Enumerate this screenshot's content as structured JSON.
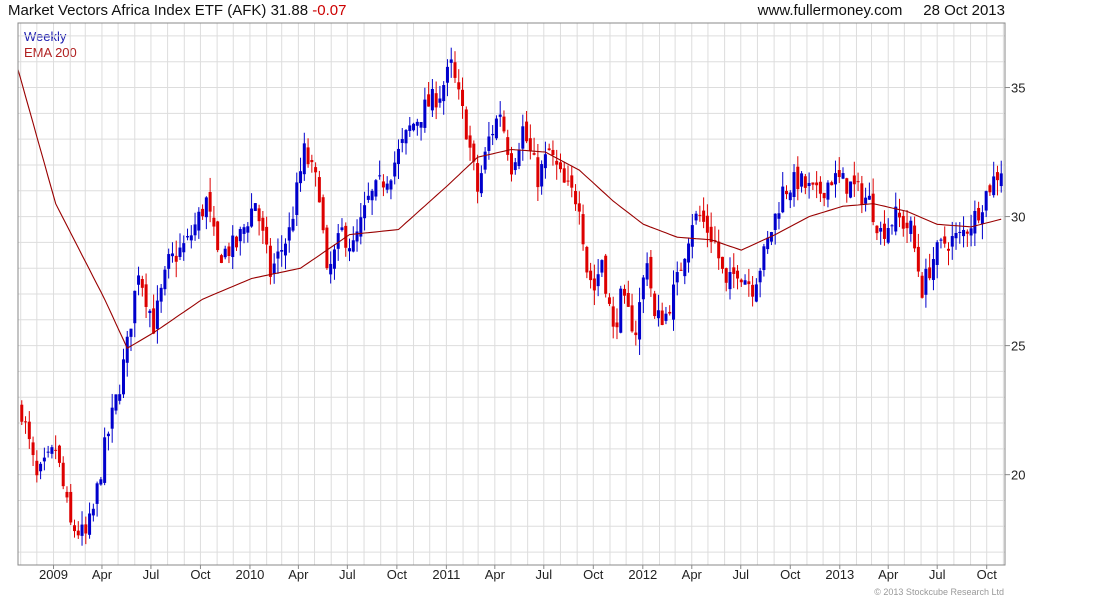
{
  "header": {
    "instrument": "Market Vectors Africa Index ETF (AFK)",
    "last": "31.88",
    "change": "-0.07",
    "source": "www.fullermoney.com",
    "date": "28 Oct 2013"
  },
  "legend": {
    "series1": "Weekly",
    "series2": "EMA 200"
  },
  "footer": {
    "copyright": "© 2013 Stockcube Research Ltd"
  },
  "colors": {
    "up": "#0000cc",
    "down": "#dd0000",
    "ema": "#990000",
    "grid": "#dddddd"
  },
  "chart_data": {
    "type": "bar",
    "subtype": "weekly candlestick with 200-period EMA",
    "x_range": [
      "2008-10-27",
      "2013-11-04"
    ],
    "y_range": [
      16.5,
      37.5
    ],
    "y_ticks": [
      20,
      25,
      30,
      35
    ],
    "x_ticks": [
      {
        "label": "2009",
        "date": "2009-01-01"
      },
      {
        "label": "Apr",
        "date": "2009-04-01"
      },
      {
        "label": "Jul",
        "date": "2009-07-01"
      },
      {
        "label": "Oct",
        "date": "2009-10-01"
      },
      {
        "label": "2010",
        "date": "2010-01-01"
      },
      {
        "label": "Apr",
        "date": "2010-04-01"
      },
      {
        "label": "Jul",
        "date": "2010-07-01"
      },
      {
        "label": "Oct",
        "date": "2010-10-01"
      },
      {
        "label": "2011",
        "date": "2011-01-01"
      },
      {
        "label": "Apr",
        "date": "2011-04-01"
      },
      {
        "label": "Jul",
        "date": "2011-07-01"
      },
      {
        "label": "Oct",
        "date": "2011-10-01"
      },
      {
        "label": "2012",
        "date": "2012-01-01"
      },
      {
        "label": "Apr",
        "date": "2012-04-01"
      },
      {
        "label": "Jul",
        "date": "2012-07-01"
      },
      {
        "label": "Oct",
        "date": "2012-10-01"
      },
      {
        "label": "2013",
        "date": "2013-01-01"
      },
      {
        "label": "Apr",
        "date": "2013-04-01"
      },
      {
        "label": "Jul",
        "date": "2013-07-01"
      },
      {
        "label": "Oct",
        "date": "2013-10-01"
      }
    ],
    "close_anchors": [
      [
        "2008-11-03",
        22.5
      ],
      [
        "2008-12-01",
        19.8
      ],
      [
        "2009-01-05",
        21.0
      ],
      [
        "2009-02-02",
        18.0
      ],
      [
        "2009-03-02",
        17.6
      ],
      [
        "2009-03-16",
        18.6
      ],
      [
        "2009-04-06",
        21.0
      ],
      [
        "2009-05-04",
        23.5
      ],
      [
        "2009-05-18",
        25.0
      ],
      [
        "2009-06-08",
        28.0
      ],
      [
        "2009-07-06",
        25.8
      ],
      [
        "2009-08-03",
        28.2
      ],
      [
        "2009-09-07",
        29.0
      ],
      [
        "2009-10-12",
        30.6
      ],
      [
        "2009-11-02",
        28.5
      ],
      [
        "2009-12-07",
        28.9
      ],
      [
        "2010-01-11",
        30.6
      ],
      [
        "2010-02-08",
        27.8
      ],
      [
        "2010-03-15",
        29.4
      ],
      [
        "2010-04-12",
        32.5
      ],
      [
        "2010-05-10",
        31.0
      ],
      [
        "2010-05-24",
        27.6
      ],
      [
        "2010-06-21",
        29.4
      ],
      [
        "2010-07-12",
        28.8
      ],
      [
        "2010-08-09",
        30.6
      ],
      [
        "2010-09-20",
        31.8
      ],
      [
        "2010-10-25",
        33.4
      ],
      [
        "2010-11-22",
        34.2
      ],
      [
        "2010-12-20",
        34.8
      ],
      [
        "2011-01-10",
        35.8
      ],
      [
        "2011-02-07",
        33.4
      ],
      [
        "2011-02-28",
        31.0
      ],
      [
        "2011-03-21",
        33.0
      ],
      [
        "2011-04-11",
        34.1
      ],
      [
        "2011-05-02",
        32.0
      ],
      [
        "2011-05-23",
        33.4
      ],
      [
        "2011-06-20",
        31.5
      ],
      [
        "2011-07-11",
        32.5
      ],
      [
        "2011-08-08",
        31.2
      ],
      [
        "2011-09-05",
        30.6
      ],
      [
        "2011-09-19",
        28.0
      ],
      [
        "2011-10-03",
        27.2
      ],
      [
        "2011-10-17",
        28.4
      ],
      [
        "2011-11-07",
        25.5
      ],
      [
        "2011-11-21",
        26.8
      ],
      [
        "2011-12-19",
        25.6
      ],
      [
        "2012-01-09",
        28.5
      ],
      [
        "2012-01-23",
        26.0
      ],
      [
        "2012-02-13",
        26.2
      ],
      [
        "2012-03-05",
        27.5
      ],
      [
        "2012-04-02",
        29.9
      ],
      [
        "2012-04-16",
        30.0
      ],
      [
        "2012-05-14",
        29.0
      ],
      [
        "2012-06-04",
        27.2
      ],
      [
        "2012-06-25",
        28.0
      ],
      [
        "2012-07-23",
        27.3
      ],
      [
        "2012-08-13",
        28.5
      ],
      [
        "2012-09-17",
        31.0
      ],
      [
        "2012-10-15",
        31.4
      ],
      [
        "2012-11-19",
        30.8
      ],
      [
        "2012-12-17",
        31.5
      ],
      [
        "2013-01-21",
        31.2
      ],
      [
        "2013-02-25",
        30.6
      ],
      [
        "2013-03-18",
        29.4
      ],
      [
        "2013-04-15",
        30.0
      ],
      [
        "2013-05-13",
        29.5
      ],
      [
        "2013-06-03",
        27.2
      ],
      [
        "2013-06-24",
        28.4
      ],
      [
        "2013-07-15",
        29.0
      ],
      [
        "2013-08-12",
        29.2
      ],
      [
        "2013-09-09",
        30.0
      ],
      [
        "2013-10-07",
        31.2
      ],
      [
        "2013-10-28",
        31.88
      ]
    ],
    "ema_anchors": [
      [
        "2008-10-27",
        35.7
      ],
      [
        "2009-01-05",
        30.5
      ],
      [
        "2009-04-06",
        26.8
      ],
      [
        "2009-05-18",
        24.9
      ],
      [
        "2009-07-06",
        25.5
      ],
      [
        "2009-10-05",
        26.8
      ],
      [
        "2010-01-04",
        27.6
      ],
      [
        "2010-04-05",
        28.0
      ],
      [
        "2010-07-05",
        29.3
      ],
      [
        "2010-10-04",
        29.5
      ],
      [
        "2011-01-03",
        31.2
      ],
      [
        "2011-02-28",
        32.3
      ],
      [
        "2011-05-02",
        32.6
      ],
      [
        "2011-07-04",
        32.5
      ],
      [
        "2011-09-05",
        31.8
      ],
      [
        "2011-11-07",
        30.6
      ],
      [
        "2012-01-02",
        29.7
      ],
      [
        "2012-03-05",
        29.2
      ],
      [
        "2012-05-07",
        29.1
      ],
      [
        "2012-07-02",
        28.7
      ],
      [
        "2012-09-03",
        29.3
      ],
      [
        "2012-11-05",
        30.0
      ],
      [
        "2013-01-07",
        30.4
      ],
      [
        "2013-03-04",
        30.5
      ],
      [
        "2013-05-06",
        30.2
      ],
      [
        "2013-07-01",
        29.7
      ],
      [
        "2013-09-02",
        29.6
      ],
      [
        "2013-10-28",
        29.9
      ]
    ]
  }
}
